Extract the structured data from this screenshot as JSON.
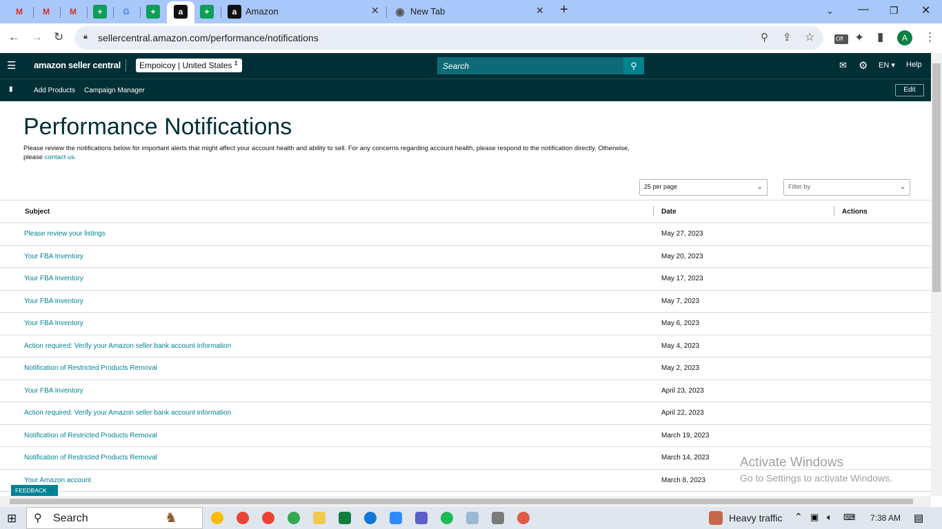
{
  "browser": {
    "tabs": [
      {
        "title": "Amazon"
      },
      {
        "title": "New Tab"
      }
    ],
    "url": "sellercentral.amazon.com/performance/notifications",
    "extension_badge": "Off",
    "profile_initial": "A"
  },
  "header": {
    "logo": "amazon seller central",
    "store": "Empoicoy | United States",
    "search_placeholder": "Search",
    "language": "EN",
    "help": "Help"
  },
  "nav": {
    "items": [
      "Add Products",
      "Campaign Manager"
    ],
    "edit": "Edit"
  },
  "page": {
    "title": "Performance Notifications",
    "desc_text": "Please review the notifications below for important alerts that might affect your account health and ability to sell. For any concerns regarding account health, please respond to the notification directly. Otherwise, please",
    "desc_link": "contact us.",
    "per_page": "25 per page",
    "filter": "Filter by",
    "columns": {
      "subject": "Subject",
      "date": "Date",
      "actions": "Actions"
    },
    "rows": [
      {
        "subject": "Please review your listings",
        "date": "May 27, 2023"
      },
      {
        "subject": "Your FBA Inventory",
        "date": "May 20, 2023"
      },
      {
        "subject": "Your FBA Inventory",
        "date": "May 17, 2023"
      },
      {
        "subject": "Your FBA Inventory",
        "date": "May 7, 2023"
      },
      {
        "subject": "Your FBA Inventory",
        "date": "May 6, 2023"
      },
      {
        "subject": "Action required: Verify your Amazon seller bank account information",
        "date": "May 4, 2023"
      },
      {
        "subject": "Notification of Restricted Products Removal",
        "date": "May 2, 2023"
      },
      {
        "subject": "Your FBA Inventory",
        "date": "April 23, 2023"
      },
      {
        "subject": "Action required: Verify your Amazon seller bank account information",
        "date": "April 22, 2023"
      },
      {
        "subject": "Notification of Restricted Products Removal",
        "date": "March 19, 2023"
      },
      {
        "subject": "Notification of Restricted Products Removal",
        "date": "March 14, 2023"
      },
      {
        "subject": "Your Amazon account",
        "date": "March 8, 2023"
      }
    ],
    "feedback": "FEEDBACK"
  },
  "watermark": {
    "line1": "Activate Windows",
    "line2": "Go to Settings to activate Windows."
  },
  "taskbar": {
    "search": "Search",
    "weather": "Heavy traffic",
    "time": "7:38 AM"
  }
}
